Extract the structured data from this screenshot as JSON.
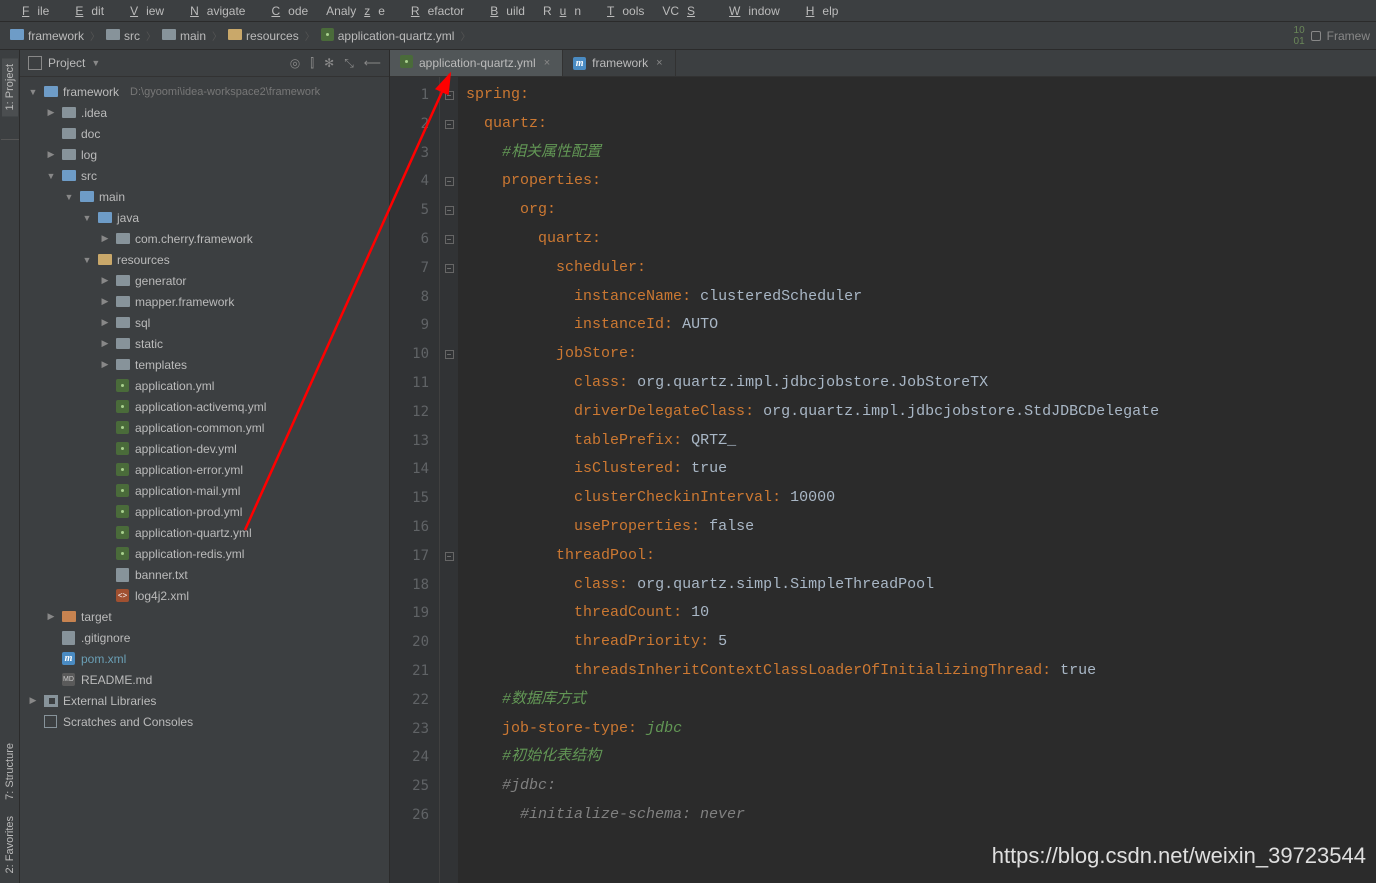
{
  "menu": {
    "file": "File",
    "edit": "Edit",
    "view": "View",
    "navigate": "Navigate",
    "code": "Code",
    "analyze": "Analyze",
    "refactor": "Refactor",
    "build": "Build",
    "run": "Run",
    "tools": "Tools",
    "vcs": "VCS",
    "window": "Window",
    "help": "Help"
  },
  "breadcrumbs": [
    {
      "icon": "folder-blue",
      "label": "framework"
    },
    {
      "icon": "folder",
      "label": "src"
    },
    {
      "icon": "folder",
      "label": "main"
    },
    {
      "icon": "rsrc",
      "label": "resources"
    },
    {
      "icon": "yml",
      "label": "application-quartz.yml"
    }
  ],
  "navRight": {
    "label": "Framew"
  },
  "sidebar": {
    "title": "Project",
    "icons": {
      "target": "◎",
      "split": "⫿",
      "gear": "✻",
      "collapse": "⤡",
      "hide": "⟵"
    },
    "tree": [
      {
        "d": 0,
        "tw": "▼",
        "ico": "folder-blue",
        "lbl": "framework",
        "hint": "D:\\gyoomi\\idea-workspace2\\framework"
      },
      {
        "d": 1,
        "tw": "▶",
        "ico": "folder",
        "lbl": ".idea"
      },
      {
        "d": 1,
        "tw": "",
        "ico": "folder",
        "lbl": "doc"
      },
      {
        "d": 1,
        "tw": "▶",
        "ico": "folder",
        "lbl": "log"
      },
      {
        "d": 1,
        "tw": "▼",
        "ico": "folder-blue",
        "lbl": "src"
      },
      {
        "d": 2,
        "tw": "▼",
        "ico": "folder-blue",
        "lbl": "main"
      },
      {
        "d": 3,
        "tw": "▼",
        "ico": "folder-blue",
        "lbl": "java"
      },
      {
        "d": 4,
        "tw": "▶",
        "ico": "folder",
        "lbl": "com.cherry.framework"
      },
      {
        "d": 3,
        "tw": "▼",
        "ico": "rsrc",
        "lbl": "resources"
      },
      {
        "d": 4,
        "tw": "▶",
        "ico": "folder",
        "lbl": "generator"
      },
      {
        "d": 4,
        "tw": "▶",
        "ico": "folder",
        "lbl": "mapper.framework"
      },
      {
        "d": 4,
        "tw": "▶",
        "ico": "folder",
        "lbl": "sql"
      },
      {
        "d": 4,
        "tw": "▶",
        "ico": "folder",
        "lbl": "static"
      },
      {
        "d": 4,
        "tw": "▶",
        "ico": "folder",
        "lbl": "templates"
      },
      {
        "d": 4,
        "tw": "",
        "ico": "yml",
        "lbl": "application.yml"
      },
      {
        "d": 4,
        "tw": "",
        "ico": "yml",
        "lbl": "application-activemq.yml"
      },
      {
        "d": 4,
        "tw": "",
        "ico": "yml",
        "lbl": "application-common.yml"
      },
      {
        "d": 4,
        "tw": "",
        "ico": "yml",
        "lbl": "application-dev.yml"
      },
      {
        "d": 4,
        "tw": "",
        "ico": "yml",
        "lbl": "application-error.yml"
      },
      {
        "d": 4,
        "tw": "",
        "ico": "yml",
        "lbl": "application-mail.yml"
      },
      {
        "d": 4,
        "tw": "",
        "ico": "yml",
        "lbl": "application-prod.yml"
      },
      {
        "d": 4,
        "tw": "",
        "ico": "yml",
        "lbl": "application-quartz.yml"
      },
      {
        "d": 4,
        "tw": "",
        "ico": "yml",
        "lbl": "application-redis.yml"
      },
      {
        "d": 4,
        "tw": "",
        "ico": "file",
        "lbl": "banner.txt"
      },
      {
        "d": 4,
        "tw": "",
        "ico": "xml",
        "lbl": "log4j2.xml"
      },
      {
        "d": 1,
        "tw": "▶",
        "ico": "folder-orange",
        "lbl": "target"
      },
      {
        "d": 1,
        "tw": "",
        "ico": "file",
        "lbl": ".gitignore"
      },
      {
        "d": 1,
        "tw": "",
        "ico": "m",
        "lbl": "pom.xml",
        "cls": "pom"
      },
      {
        "d": 1,
        "tw": "",
        "ico": "md",
        "lbl": "README.md"
      },
      {
        "d": 0,
        "tw": "▶",
        "ico": "lib",
        "lbl": "External Libraries"
      },
      {
        "d": 0,
        "tw": "",
        "ico": "scratch",
        "lbl": "Scratches and Consoles"
      }
    ]
  },
  "leftTabs": {
    "project": "1: Project",
    "structure": "7: Structure",
    "favorites": "2: Favorites"
  },
  "editorTabs": [
    {
      "icon": "yml",
      "label": "application-quartz.yml",
      "active": true
    },
    {
      "icon": "m",
      "label": "framework",
      "active": false
    }
  ],
  "code": {
    "lines": [
      {
        "n": 1,
        "t": "<k>spring</k><kv>:</kv>"
      },
      {
        "n": 2,
        "t": "  <k>quartz</k><kv>:</kv>"
      },
      {
        "n": 3,
        "t": "    <c>#相关属性配置</c>"
      },
      {
        "n": 4,
        "t": "    <k>properties</k><kv>:</kv>"
      },
      {
        "n": 5,
        "t": "      <k>org</k><kv>:</kv>"
      },
      {
        "n": 6,
        "t": "        <k>quartz</k><kv>:</kv>"
      },
      {
        "n": 7,
        "t": "          <k>scheduler</k><kv>:</kv>"
      },
      {
        "n": 8,
        "t": "            <k>instanceName</k><kv>:</kv> <s>clusteredScheduler</s>"
      },
      {
        "n": 9,
        "t": "            <k>instanceId</k><kv>:</kv> <s>AUTO</s>"
      },
      {
        "n": 10,
        "t": "          <k>jobStore</k><kv>:</kv>"
      },
      {
        "n": 11,
        "t": "            <k>class</k><kv>:</kv> <s>org.quartz.impl.jdbcjobstore.JobStoreTX</s>"
      },
      {
        "n": 12,
        "t": "            <k>driverDelegateClass</k><kv>:</kv> <s>org.quartz.impl.jdbcjobstore.StdJDBCDelegate</s>"
      },
      {
        "n": 13,
        "t": "            <k>tablePrefix</k><kv>:</kv> <s>QRTZ_</s>"
      },
      {
        "n": 14,
        "t": "            <k>isClustered</k><kv>:</kv> <s>true</s>"
      },
      {
        "n": 15,
        "t": "            <k>clusterCheckinInterval</k><kv>:</kv> <s>10000</s>"
      },
      {
        "n": 16,
        "t": "            <k>useProperties</k><kv>:</kv> <s>false</s>"
      },
      {
        "n": 17,
        "t": "          <k>threadPool</k><kv>:</kv>"
      },
      {
        "n": 18,
        "t": "            <k>class</k><kv>:</kv> <s>org.quartz.simpl.SimpleThreadPool</s>"
      },
      {
        "n": 19,
        "t": "            <k>threadCount</k><kv>:</kv> <s>10</s>"
      },
      {
        "n": 20,
        "t": "            <k>threadPriority</k><kv>:</kv> <s>5</s>"
      },
      {
        "n": 21,
        "t": "            <k>threadsInheritContextClassLoaderOfInitializingThread</k><kv>:</kv> <s>true</s>"
      },
      {
        "n": 22,
        "t": "    <c>#数据库方式</c>"
      },
      {
        "n": 23,
        "t": "    <k>job-store-type</k><kv>:</kv> <it>jdbc</it>"
      },
      {
        "n": 24,
        "t": "    <c>#初始化表结构</c>"
      },
      {
        "n": 25,
        "t": "    <cc>#jdbc:</cc>"
      },
      {
        "n": 26,
        "t": "      <cc>#initialize-schema: never</cc>"
      }
    ]
  },
  "watermark": "https://blog.csdn.net/weixin_39723544"
}
